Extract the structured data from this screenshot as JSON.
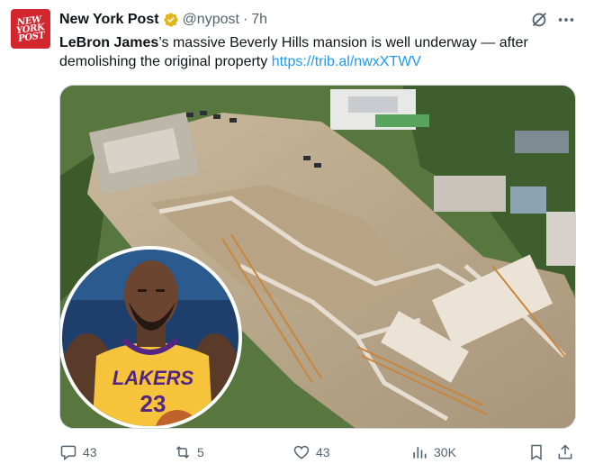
{
  "account": {
    "name": "New York Post",
    "handle": "@nypost",
    "separator": "·",
    "time": "7h",
    "avatar_text": [
      "NEW",
      "YORK",
      "POST"
    ]
  },
  "post": {
    "name_highlight": "LeBron James",
    "text_rest": "’s massive Beverly Hills mansion is well underway — after demolishing the original property",
    "link": "https://trib.al/nwxXTWV"
  },
  "media": {
    "jersey_text": "LAKERS",
    "jersey_number": "23"
  },
  "actions": {
    "replies": "43",
    "reposts": "5",
    "likes": "43",
    "views": "30K"
  },
  "icons": [
    "verified-icon",
    "grok-icon",
    "more-icon",
    "reply-icon",
    "repost-icon",
    "like-icon",
    "views-icon",
    "bookmark-icon",
    "share-icon"
  ],
  "colors": {
    "accent": "#1d9bf0",
    "verified": "#e2b719",
    "brand": "#d3262f",
    "muted": "#536471"
  }
}
